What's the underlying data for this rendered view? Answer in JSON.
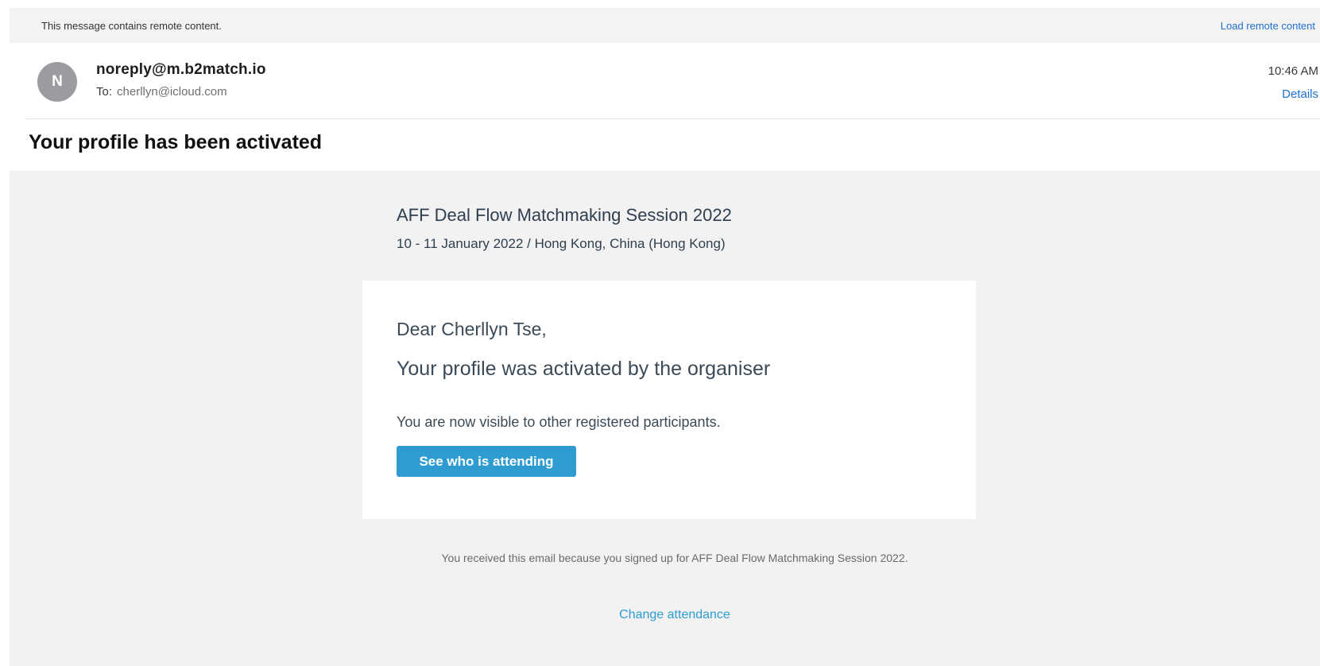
{
  "banner": {
    "message": "This message contains remote content.",
    "load_link": "Load remote content"
  },
  "header": {
    "avatar_initial": "N",
    "sender": "noreply@m.b2match.io",
    "to_label": "To:",
    "to_address": "cherllyn@icloud.com",
    "time": "10:46 AM",
    "details_link": "Details"
  },
  "subject": "Your profile has been activated",
  "email": {
    "event_title": "AFF Deal Flow Matchmaking Session 2022",
    "event_subtitle": "10 - 11 January 2022 / Hong Kong, China (Hong Kong)",
    "greeting": "Dear Cherllyn Tse,",
    "headline": "Your profile was activated by the organiser",
    "visible_text": "You are now visible to other registered participants.",
    "cta_label": "See who is attending",
    "footer_text": "You received this email because you signed up for AFF Deal Flow Matchmaking Session 2022.",
    "change_link": "Change attendance"
  },
  "colors": {
    "accent_link": "#1f6fd1",
    "button": "#2e9cd0",
    "avatar": "#9b9ba0",
    "body_bg": "#f2f2f2"
  }
}
